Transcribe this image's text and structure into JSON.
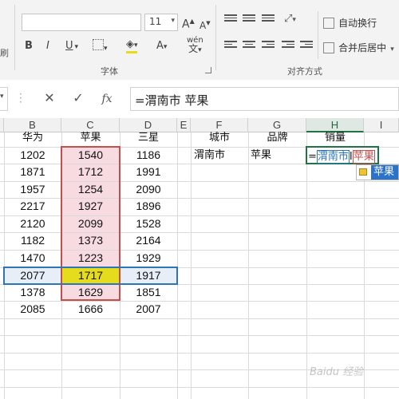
{
  "ribbon": {
    "font_size": "11",
    "bold": "B",
    "italic": "I",
    "underline": "U",
    "grow_font": "A",
    "shrink_font": "A",
    "font_color": "A",
    "phonetic": "wén",
    "font_group_label": "字体",
    "align_group_label": "对齐方式",
    "wrap_text_label": "自动换行",
    "merge_center_label": "合并后居中",
    "left_partial_label": "刷",
    "accent_color": "#217346"
  },
  "formula_bar": {
    "formula": "=渭南市 苹果",
    "cancel_icon": "close-icon",
    "confirm_icon": "check-icon",
    "fx_label": "fx"
  },
  "sheet": {
    "columns": [
      "B",
      "C",
      "D",
      "E",
      "F",
      "G",
      "H",
      "I"
    ],
    "active_column": "H",
    "headers": {
      "B": "华为",
      "C": "苹果",
      "D": "三星",
      "F": "城市",
      "G": "品牌",
      "H": "销量"
    },
    "values": {
      "B": [
        "1202",
        "1871",
        "1957",
        "2217",
        "2120",
        "1182",
        "1470",
        "2077",
        "1378",
        "2085"
      ],
      "C": [
        "1540",
        "1712",
        "1254",
        "1927",
        "2099",
        "1373",
        "1223",
        "1717",
        "1629",
        "1666"
      ],
      "D": [
        "1186",
        "1991",
        "2090",
        "1896",
        "1528",
        "2164",
        "1929",
        "1917",
        "1851",
        "2007"
      ]
    },
    "lookup": {
      "city": "渭南市",
      "brand": "苹果"
    },
    "edit_cell": {
      "prefix": "=",
      "ref1": "渭南市",
      "ref2": "苹果"
    },
    "autocomplete": "苹果",
    "highlight_colors": {
      "column": "#f7dbe1",
      "match": "#e6dc1e",
      "row": "#e7eef8",
      "column_border": "#c0504d",
      "row_border": "#2e75b6"
    }
  },
  "watermark": "Baidu 经验"
}
